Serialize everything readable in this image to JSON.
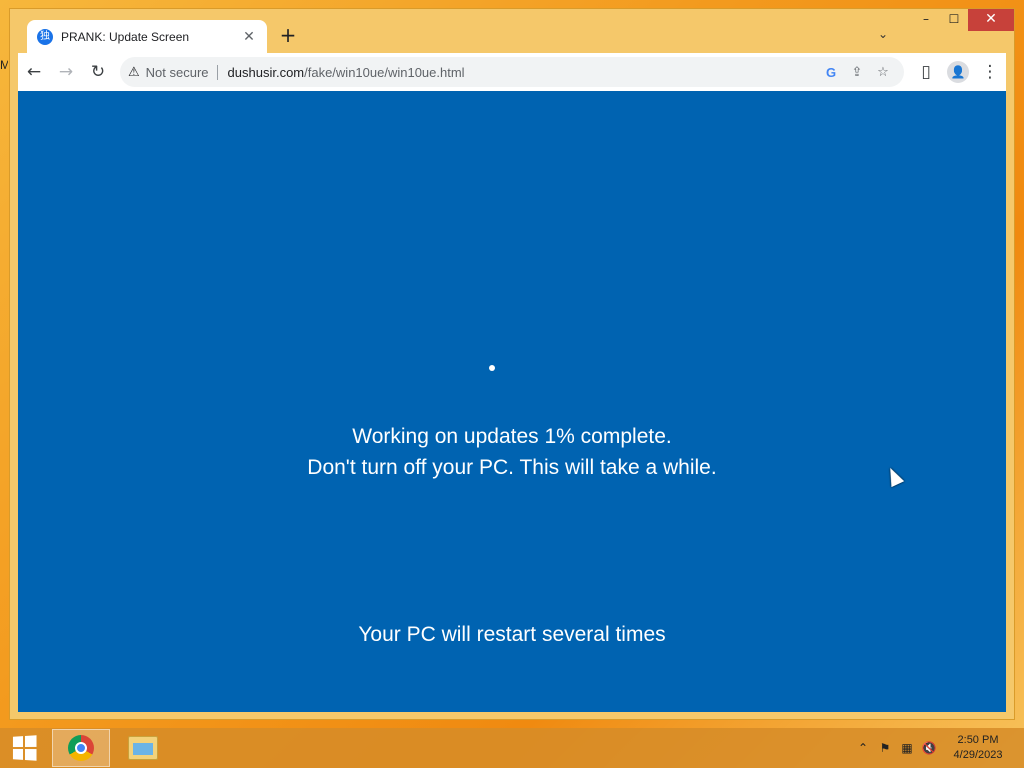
{
  "desktop": {
    "edge_glyph": "M"
  },
  "browser": {
    "tab": {
      "favicon": "独",
      "title": "PRANK: Update Screen",
      "close": "✕"
    },
    "new_tab": "+",
    "tab_search": "⌄",
    "window_controls": {
      "minimize": "–",
      "maximize": "☐",
      "close": "✕"
    },
    "toolbar": {
      "back": "←",
      "forward": "→",
      "reload": "↻",
      "security_icon": "⚠",
      "security_label": "Not secure",
      "url_host": "dushusir.com",
      "url_path": "/fake/win10ue/win10ue.html",
      "google_icon": "G",
      "share_icon": "⇪",
      "bookmark_icon": "☆",
      "sidepanel_icon": "▯",
      "profile_icon": "👤",
      "menu_icon": "⋮"
    }
  },
  "page": {
    "background": "#0063b1",
    "line1": "Working on updates  1% complete.",
    "line2": "Don't turn off your PC. This will take a while.",
    "line3": "Your PC will restart several times"
  },
  "taskbar": {
    "apps": [
      "chrome-icon",
      "file-explorer-icon"
    ],
    "tray": {
      "chevron": "⌃",
      "flag": "⚑",
      "network": "▦",
      "volume": "🔇"
    },
    "time": "2:50 PM",
    "date": "4/29/2023"
  }
}
